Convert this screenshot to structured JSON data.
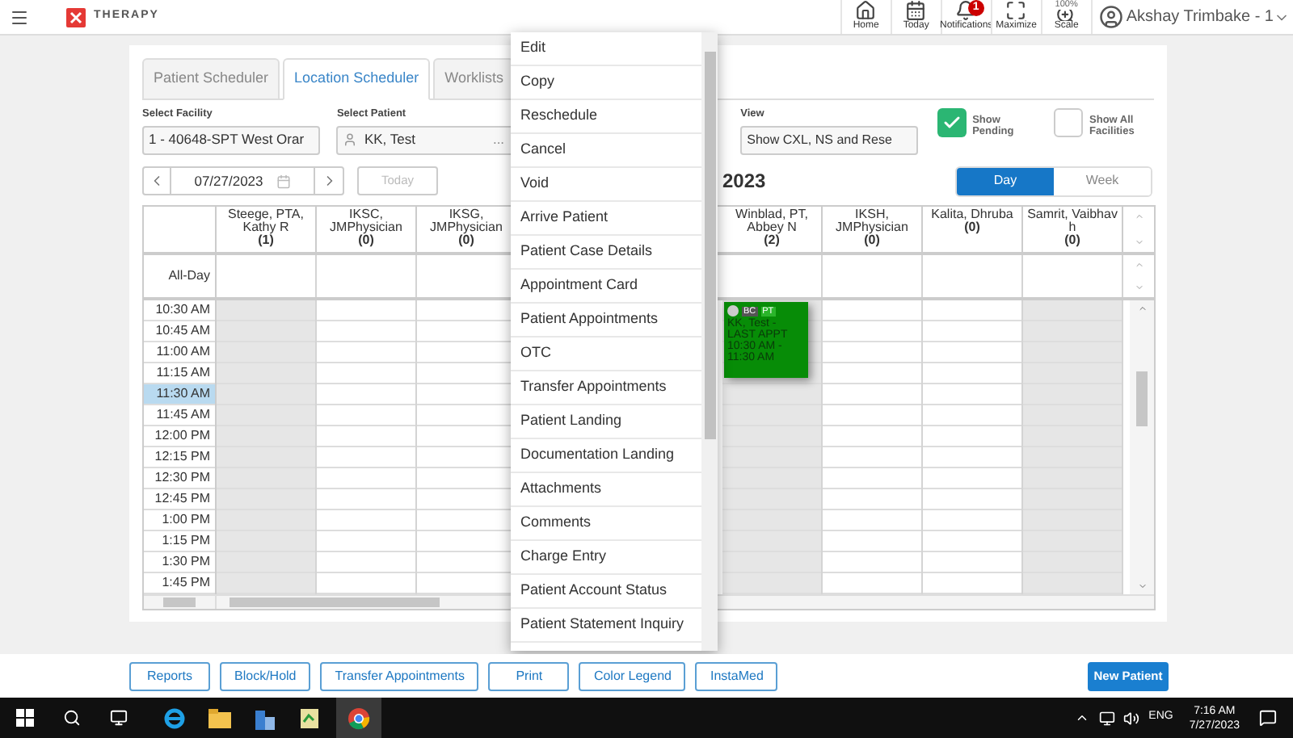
{
  "app": {
    "name": "THERAPY"
  },
  "top_nav": [
    {
      "label": "Home",
      "kind": "home"
    },
    {
      "label": "Today",
      "kind": "calendar"
    },
    {
      "label": "Notifications",
      "kind": "bell",
      "badge": "1"
    },
    {
      "label": "Maximize",
      "kind": "maximize"
    },
    {
      "label": "Scale",
      "kind": "zoom",
      "caption": "100%"
    }
  ],
  "user": {
    "name": "Akshay Trimbake - 1"
  },
  "tabs": [
    {
      "label": "Patient Scheduler",
      "selected": false
    },
    {
      "label": "Location Scheduler",
      "selected": true
    },
    {
      "label": "Worklists",
      "selected": false
    }
  ],
  "filters": {
    "facility": {
      "label": "Select Facility",
      "value": "1 - 40648-SPT West Orar"
    },
    "patient": {
      "label": "Select Patient",
      "value": "KK, Test",
      "more": "..."
    },
    "view": {
      "label": "View",
      "value": "Show CXL, NS and Rese"
    },
    "options": [
      {
        "label": "Show Pending",
        "checked": true
      },
      {
        "label": "Show All Facilities",
        "checked": false
      }
    ]
  },
  "date_nav": {
    "date": "07/27/2023",
    "today": {
      "label": "Today",
      "disabled": true
    },
    "heading": "2023"
  },
  "view_toggle": [
    {
      "label": "Day",
      "selected": true
    },
    {
      "label": "Week",
      "selected": false
    }
  ],
  "calendar": {
    "all_day_label": "All-Day",
    "columns": [
      {
        "name": "Steege, PTA, Kathy R",
        "count": "(1)",
        "unavailable": true
      },
      {
        "name": "IKSC, JMPhysician",
        "count": "(0)",
        "unavailable": false
      },
      {
        "name": "IKSG, JMPhysician",
        "count": "(0)",
        "unavailable": false
      },
      {
        "name": "Winblad, PT, Abbey N",
        "count": "(2)",
        "unavailable": true
      },
      {
        "name": "IKSH, JMPhysician",
        "count": "(0)",
        "unavailable": false
      },
      {
        "name": "Kalita, Dhruba",
        "count": "(0)",
        "unavailable": false
      },
      {
        "name": "Samrit, Vaibhav h",
        "count": "(0)",
        "unavailable": true
      }
    ],
    "times": [
      {
        "label": "10:30 AM",
        "selected": false
      },
      {
        "label": "10:45 AM",
        "selected": false
      },
      {
        "label": "11:00 AM",
        "selected": false
      },
      {
        "label": "11:15 AM",
        "selected": false
      },
      {
        "label": "11:30 AM",
        "selected": true
      },
      {
        "label": "11:45 AM",
        "selected": false
      },
      {
        "label": "12:00 PM",
        "selected": false
      },
      {
        "label": "12:15 PM",
        "selected": false
      },
      {
        "label": "12:30 PM",
        "selected": false
      },
      {
        "label": "12:45 PM",
        "selected": false
      },
      {
        "label": "1:00 PM",
        "selected": false
      },
      {
        "label": "1:15 PM",
        "selected": false
      },
      {
        "label": "1:30 PM",
        "selected": false
      },
      {
        "label": "1:45 PM",
        "selected": false
      }
    ],
    "appointment": {
      "tags": [
        "BC",
        "PT"
      ],
      "lines": [
        "KK, Test -",
        "LAST APPT",
        "10:30 AM -",
        "11:30 AM"
      ]
    }
  },
  "context_menu": [
    "Edit",
    "Copy",
    "Reschedule",
    "Cancel",
    "Void",
    "Arrive Patient",
    "Patient Case Details",
    "Appointment Card",
    "Patient Appointments",
    "OTC",
    "Transfer Appointments",
    "Patient Landing",
    "Documentation Landing",
    "Attachments",
    "Comments",
    "Charge Entry",
    "Patient Account Status",
    "Patient Statement Inquiry"
  ],
  "toolbar": [
    {
      "label": "Reports",
      "kind": "outline"
    },
    {
      "label": "Block/Hold",
      "kind": "outline"
    },
    {
      "label": "Transfer Appointments",
      "kind": "outline"
    },
    {
      "label": "Print",
      "kind": "outline"
    },
    {
      "label": "Color Legend",
      "kind": "outline"
    },
    {
      "label": "InstaMed",
      "kind": "outline"
    },
    {
      "label": "New Patient",
      "kind": "primary"
    }
  ],
  "taskbar": {
    "language": "ENG",
    "time": "7:16 AM",
    "date": "7/27/2023"
  }
}
